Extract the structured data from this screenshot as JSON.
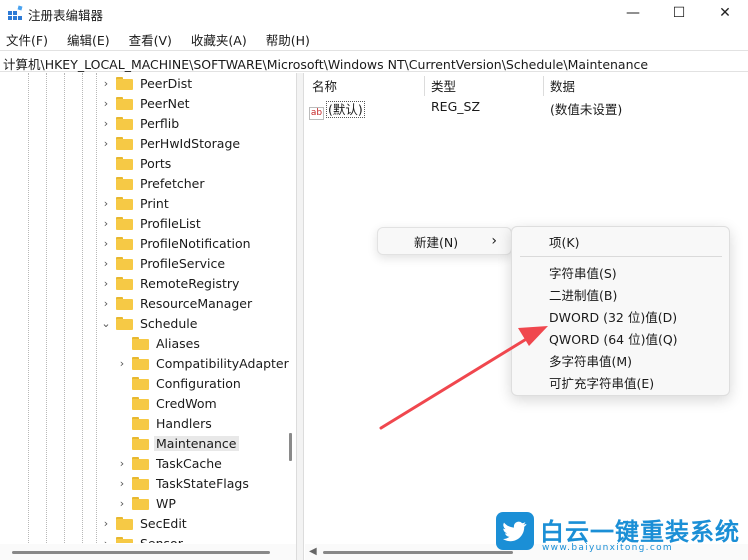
{
  "window": {
    "title": "注册表编辑器",
    "minimize": "—",
    "maximize": "☐",
    "close": "✕"
  },
  "menu": [
    "文件(F)",
    "编辑(E)",
    "查看(V)",
    "收藏夹(A)",
    "帮助(H)"
  ],
  "address": "计算机\\HKEY_LOCAL_MACHINE\\SOFTWARE\\Microsoft\\Windows NT\\CurrentVersion\\Schedule\\Maintenance",
  "tree": [
    {
      "label": "PeerDist",
      "expander": "›"
    },
    {
      "label": "PeerNet",
      "expander": "›"
    },
    {
      "label": "Perflib",
      "expander": "›"
    },
    {
      "label": "PerHwIdStorage",
      "expander": "›"
    },
    {
      "label": "Ports",
      "expander": ""
    },
    {
      "label": "Prefetcher",
      "expander": ""
    },
    {
      "label": "Print",
      "expander": "›"
    },
    {
      "label": "ProfileList",
      "expander": "›"
    },
    {
      "label": "ProfileNotification",
      "expander": "›"
    },
    {
      "label": "ProfileService",
      "expander": "›"
    },
    {
      "label": "RemoteRegistry",
      "expander": "›"
    },
    {
      "label": "ResourceManager",
      "expander": "›"
    },
    {
      "label": "Schedule",
      "expander": "⌄"
    },
    {
      "label": "Aliases",
      "expander": ""
    },
    {
      "label": "CompatibilityAdapter",
      "expander": "›"
    },
    {
      "label": "Configuration",
      "expander": ""
    },
    {
      "label": "CredWom",
      "expander": ""
    },
    {
      "label": "Handlers",
      "expander": ""
    },
    {
      "label": "Maintenance",
      "expander": ""
    },
    {
      "label": "TaskCache",
      "expander": "›"
    },
    {
      "label": "TaskStateFlags",
      "expander": "›"
    },
    {
      "label": "WP",
      "expander": "›"
    },
    {
      "label": "SecEdit",
      "expander": "›"
    },
    {
      "label": "Sensor",
      "expander": "›"
    }
  ],
  "tree_selected": "Maintenance",
  "list": {
    "columns": [
      "名称",
      "类型",
      "数据"
    ],
    "rows": [
      {
        "icon": "ab",
        "name": "(默认)",
        "type": "REG_SZ",
        "data": "(数值未设置)"
      }
    ]
  },
  "context_menu": {
    "item": "新建(N)",
    "submenu_arrow": "›"
  },
  "submenu": [
    "项(K)",
    "字符串值(S)",
    "二进制值(B)",
    "DWORD (32 位)值(D)",
    "QWORD (64 位)值(Q)",
    "多字符串值(M)",
    "可扩充字符串值(E)"
  ],
  "watermark": {
    "text": "白云一键重装系统",
    "url": "www.baiyunxitong.com"
  },
  "colors": {
    "folder": "#f6c945",
    "arrow": "#f0474e",
    "watermark": "#1b8fd6"
  },
  "icons": {
    "app": "registry-editor-icon",
    "folder": "folder-icon",
    "value": "string-value-icon"
  }
}
